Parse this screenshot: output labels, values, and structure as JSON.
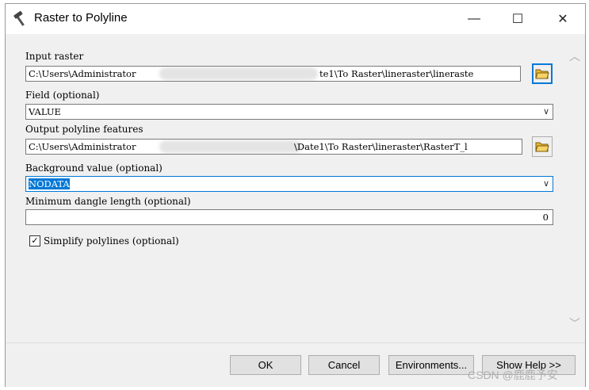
{
  "window": {
    "title": "Raster to Polyline",
    "icon": "hammer-icon",
    "controls": {
      "minimize": "—",
      "maximize": "☐",
      "close": "✕"
    }
  },
  "form": {
    "input_raster": {
      "label": "Input raster",
      "value_start": "C:\\Users\\Administrator",
      "value_end": "te1\\To Raster\\lineraster\\lineraste"
    },
    "field": {
      "label": "Field (optional)",
      "value": "VALUE"
    },
    "output": {
      "label": "Output polyline features",
      "value_start": "C:\\Users\\Administrator",
      "value_end": "\\Date1\\To Raster\\lineraster\\RasterT_l"
    },
    "background": {
      "label": "Background value (optional)",
      "value": "NODATA"
    },
    "dangle": {
      "label": "Minimum dangle length (optional)",
      "value": "0"
    },
    "simplify": {
      "label": "Simplify polylines (optional)",
      "checked": true
    }
  },
  "buttons": {
    "ok": "OK",
    "cancel": "Cancel",
    "environments": "Environments...",
    "help": "Show Help >>"
  },
  "watermark": "CSDN @鹿鹿予安",
  "colors": {
    "accent": "#0078d7",
    "folder": "#e8b830"
  }
}
